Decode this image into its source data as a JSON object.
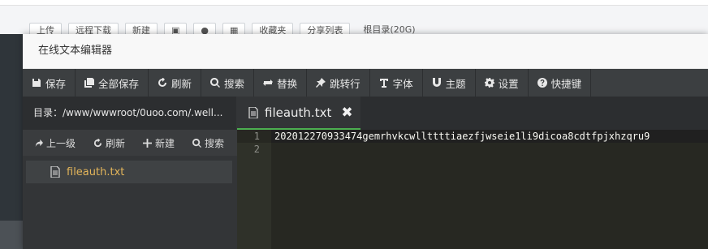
{
  "background": {
    "toolbar_buttons": [
      "上传",
      "远程下载",
      "新建",
      "",
      "",
      "",
      "收藏夹",
      "分享列表"
    ],
    "disk_label": "根目录(20G)"
  },
  "modal": {
    "title": "在线文本编辑器"
  },
  "toolbar": {
    "items": [
      {
        "label": "保存",
        "icon": "save-icon"
      },
      {
        "label": "全部保存",
        "icon": "save-all-icon"
      },
      {
        "label": "刷新",
        "icon": "refresh-icon"
      },
      {
        "label": "搜索",
        "icon": "search-icon"
      },
      {
        "label": "替换",
        "icon": "replace-icon"
      },
      {
        "label": "跳转行",
        "icon": "pin-icon"
      },
      {
        "label": "字体",
        "icon": "font-icon"
      },
      {
        "label": "主题",
        "icon": "magnet-icon"
      },
      {
        "label": "设置",
        "icon": "gear-icon"
      },
      {
        "label": "快捷键",
        "icon": "help-icon"
      }
    ]
  },
  "sidebar": {
    "path": "目录：/www/wwwroot/0uoo.com/.well...",
    "actions": {
      "up": "上一级",
      "refresh": "刷新",
      "new": "新建",
      "search": "搜索"
    },
    "file": "fileauth.txt"
  },
  "editor": {
    "tab_label": "fileauth.txt",
    "close_glyph": "✖",
    "line_numbers": [
      "1",
      "2"
    ],
    "line1": "202012270933474gemrhvkcwllttttiaezfjwseie1li9dicoa8cdtfpjxhzqru9"
  }
}
